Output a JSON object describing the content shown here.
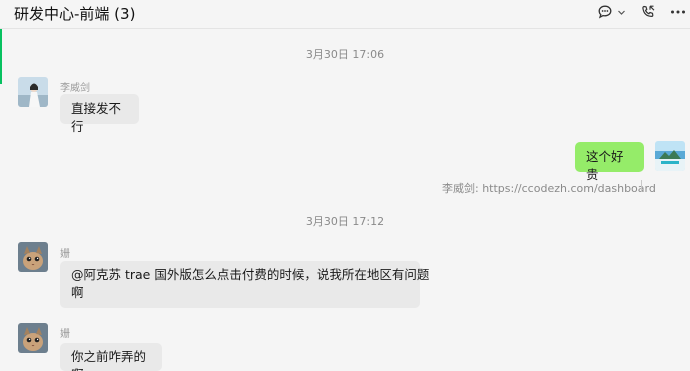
{
  "header": {
    "title": "研发中心-前端 (3)",
    "icons": [
      "chat-bubble-icon",
      "chevron-down-icon",
      "phone-icon",
      "more-icon"
    ]
  },
  "timestamps": [
    "3月30日 17:06",
    "3月30日 17:12"
  ],
  "messages": [
    {
      "sender": "李威剑",
      "text": "直接发不行",
      "direction": "incoming"
    },
    {
      "text": "这个好贵",
      "direction": "outgoing"
    },
    {
      "quote": "李威剑: https://ccodezh.com/dashboard"
    },
    {
      "sender": "姗",
      "text_line1": "@阿克苏  trae 国外版怎么点击付费的时候，说我所在地区有问题",
      "text_line2": "啊",
      "direction": "incoming"
    },
    {
      "sender": "姗",
      "text": "你之前咋弄的啊",
      "direction": "incoming"
    }
  ],
  "colors": {
    "accent": "#07c160",
    "outgoing_bubble": "#95ec69",
    "incoming_bubble": "#e9e9e9",
    "background": "#f5f5f5"
  }
}
